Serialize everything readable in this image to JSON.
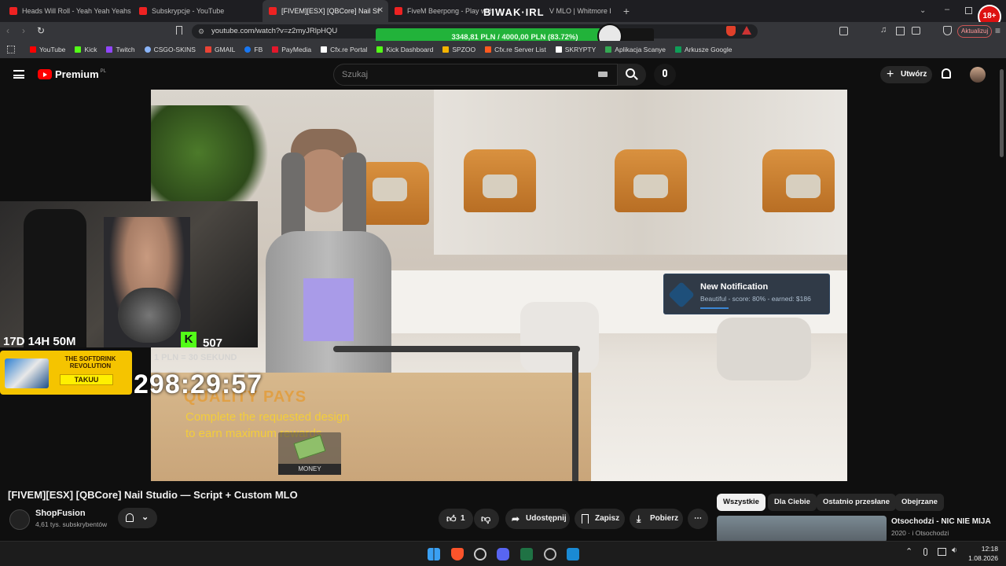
{
  "browser": {
    "tabs": [
      {
        "title": "Heads Will Roll - Yeah Yeah Yeahs (Ly"
      },
      {
        "title": "Subskrypcje - YouTube"
      },
      {
        "title": "[FIVEM][ESX] [QBCore] Nail St"
      },
      {
        "title": "FiveM Beerpong - Play with"
      },
      {
        "title": "V MLO | Whitmore Estate - YouT"
      }
    ],
    "url": "youtube.com/watch?v=z2myJRlpHQU",
    "update_label": "Aktualizuj",
    "bookmarks": [
      {
        "label": "YouTube",
        "color": "#ff0000"
      },
      {
        "label": "Kick",
        "color": "#53fc18"
      },
      {
        "label": "Twitch",
        "color": "#9146ff"
      },
      {
        "label": "CSGO-SKINS",
        "color": "#8ab4f8"
      },
      {
        "label": "GMAIL",
        "color": "#ea4335"
      },
      {
        "label": "FB",
        "color": "#1877f2"
      },
      {
        "label": "PayMedia",
        "color": "#e4172b"
      },
      {
        "label": "Cfx.re Portal",
        "color": "#ffffff"
      },
      {
        "label": "Kick Dashboard",
        "color": "#53fc18"
      },
      {
        "label": "SPZOO",
        "color": "#f4b400"
      },
      {
        "label": "Cfx.re Server List",
        "color": "#ff5a1f"
      },
      {
        "label": "SKRYPTY",
        "color": "#ffffff"
      },
      {
        "label": "Aplikacja Scanye",
        "color": "#34a853"
      },
      {
        "label": "Arkusze Google",
        "color": "#0f9d58"
      }
    ]
  },
  "donation": {
    "brand": "BIWAK·IRL",
    "text": "3348,81 PLN / 4000,00 PLN (83.72%)",
    "progress_pct": 83.72
  },
  "youtube": {
    "logo_text": "Premium",
    "logo_region": "PL",
    "search_placeholder": "Szukaj",
    "create_label": "Utwórz"
  },
  "video": {
    "notification_title": "New Notification",
    "notification_body": "Beautiful - score: 80% - earned: $186",
    "quality_title": "QUALITY PAYS",
    "quality_line1": "Complete the requested design",
    "quality_line2": "to earn maximum rewards",
    "money_label": "MONEY"
  },
  "overlay": {
    "countdown": "17D 14H 50M",
    "kick_count": "507",
    "sekund": "1 PLN = 30 SEKUND",
    "promo_title": "THE SOFTDRINK REVOLUTION",
    "promo_button": "TAKUU",
    "timer": "298:29:57"
  },
  "watch": {
    "title": "[FIVEM][ESX] [QBCore] Nail Studio — Script + Custom MLO",
    "channel_name": "ShopFusion",
    "channel_subs": "4,61 tys. subskrybentów",
    "like_count": "1",
    "share_label": "Udostępnij",
    "save_label": "Zapisz",
    "download_label": "Pobierz",
    "chips": [
      "Wszystkie",
      "Dla Ciebie",
      "Ostatnio przesłane",
      "Obejrzane"
    ],
    "rec_title": "Otsochodzi - NIC NIE MIJA",
    "rec_meta": "2020 · i Otsochodzi"
  },
  "taskbar": {
    "time": "12:18",
    "date": "1.08.2026"
  }
}
